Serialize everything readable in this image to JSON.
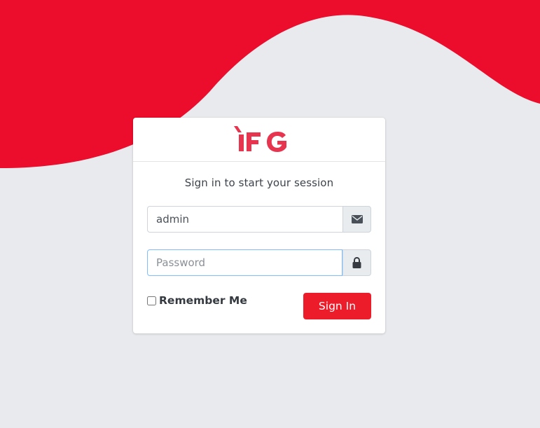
{
  "brand": {
    "logo_text": "IFG",
    "accent_color": "#ec1c2b",
    "background_color": "#e9eaee"
  },
  "login": {
    "message": "Sign in to start your session",
    "username_value": "admin",
    "password_placeholder": "Password",
    "remember_label": "Remember Me",
    "remember_checked": false,
    "submit_label": "Sign In"
  },
  "icons": {
    "username_addon": "envelope-icon",
    "password_addon": "lock-icon"
  }
}
